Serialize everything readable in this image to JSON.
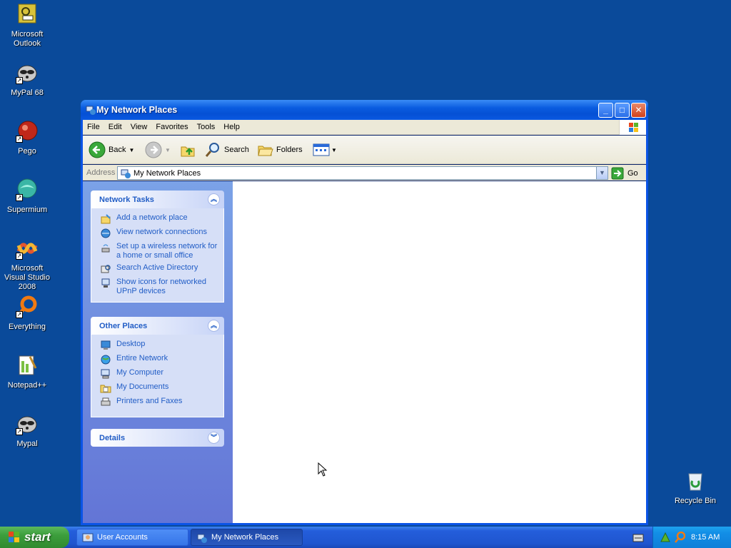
{
  "desktop": {
    "icons": [
      {
        "label": "Microsoft Outlook"
      },
      {
        "label": "MyPal 68"
      },
      {
        "label": "Pego"
      },
      {
        "label": "Supermium"
      },
      {
        "label": "Microsoft Visual Studio 2008"
      },
      {
        "label": "Everything"
      },
      {
        "label": "Notepad++"
      },
      {
        "label": "Mypal"
      },
      {
        "label": "Recycle Bin"
      }
    ]
  },
  "window": {
    "title": "My Network Places",
    "menu": [
      "File",
      "Edit",
      "View",
      "Favorites",
      "Tools",
      "Help"
    ],
    "toolbar": {
      "back": "Back",
      "search": "Search",
      "folders": "Folders"
    },
    "address": {
      "label": "Address",
      "value": "My Network Places",
      "go": "Go"
    },
    "panels": {
      "network_tasks": {
        "title": "Network Tasks",
        "items": [
          "Add a network place",
          "View network connections",
          "Set up a wireless network for a home or small office",
          "Search Active Directory",
          "Show icons for networked UPnP devices"
        ]
      },
      "other_places": {
        "title": "Other Places",
        "items": [
          "Desktop",
          "Entire Network",
          "My Computer",
          "My Documents",
          "Printers and Faxes"
        ]
      },
      "details": {
        "title": "Details"
      }
    }
  },
  "taskbar": {
    "start": "start",
    "tasks": [
      "User Accounts",
      "My Network Places"
    ],
    "clock": "8:15 AM"
  },
  "colors": {
    "desktop": "#0a4a9a",
    "link": "#215dc6",
    "title_bar": "#0a5ce0"
  }
}
